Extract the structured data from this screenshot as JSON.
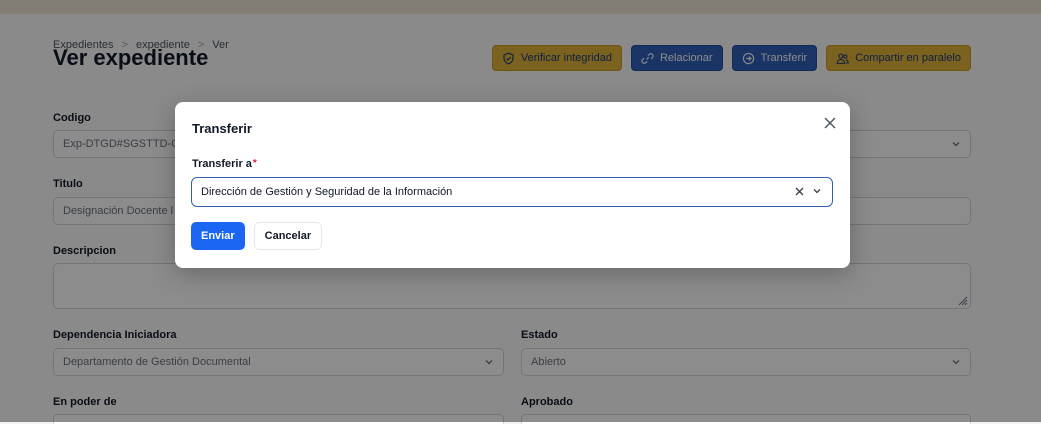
{
  "breadcrumb": {
    "items": [
      "Expedientes",
      "expediente",
      "Ver"
    ],
    "separator": ">"
  },
  "page": {
    "title": "Ver expediente"
  },
  "actions": {
    "verify_label": "Verificar integridad",
    "relate_label": "Relacionar",
    "transfer_label": "Transferir",
    "share_label": "Compartir en paralelo"
  },
  "form": {
    "codigo": {
      "label": "Codigo",
      "value": "Exp-DTGD#SGSTTD-C"
    },
    "titulo": {
      "label": "Titulo",
      "value": "Designación Docente l"
    },
    "descripcion": {
      "label": "Descripcion",
      "value": ""
    },
    "dependencia": {
      "label": "Dependencia Iniciadora",
      "value": "Departamento de Gestión Documental"
    },
    "estado": {
      "label": "Estado",
      "value": "Abierto"
    },
    "en_poder_de": {
      "label": "En poder de"
    },
    "aprobado": {
      "label": "Aprobado"
    }
  },
  "modal": {
    "title": "Transferir",
    "field_label": "Transferir a",
    "required_mark": "*",
    "selected_value": "Dirección de Gestión y Seguridad de la Información",
    "submit_label": "Enviar",
    "cancel_label": "Cancelar"
  },
  "colors": {
    "accent_yellow": "#e2b23a",
    "accent_blue": "#2f5fb8",
    "primary_button": "#1a66f0",
    "required": "#e11d48"
  },
  "icons": {
    "verify": "shield-check-icon",
    "relate": "link-icon",
    "transfer": "arrow-circle-right-icon",
    "share": "users-icon",
    "close": "close-icon",
    "clear": "clear-icon",
    "dropdown": "chevron-down-icon"
  }
}
